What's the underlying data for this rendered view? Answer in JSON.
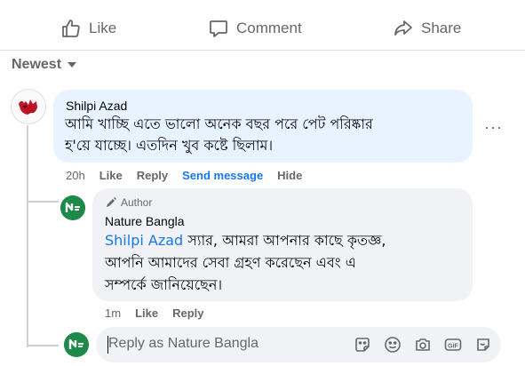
{
  "actions": {
    "like": "Like",
    "comment": "Comment",
    "share": "Share"
  },
  "sort": {
    "label": "Newest"
  },
  "comment": {
    "author": "Shilpi Azad",
    "text_line1": "আমি খাচ্ছি এতে ভালো অনেক বছর পরে পেট পরিষ্কার",
    "text_line2": "হ'য়ে যাচ্ছে। এতদিন খুব কষ্টে ছিলাম।",
    "time": "20h",
    "like": "Like",
    "reply": "Reply",
    "send_message": "Send message",
    "hide": "Hide",
    "more": "···"
  },
  "reply": {
    "badge": "Author",
    "author": "Nature Bangla",
    "mention": "Shilpi Azad",
    "text_line1": " স্যার, আমরা আপনার কাছে কৃতজ্ঞ,",
    "text_line2": "আপনি আমাদের সেবা গ্রহণ করেছেন এবং এ",
    "text_line3": "সম্পর্কে জানিয়েছেন।",
    "time": "1m",
    "like": "Like",
    "reply": "Reply"
  },
  "composer": {
    "placeholder": "Reply as Nature Bangla",
    "icons": [
      "sticker-icon",
      "emoji-icon",
      "camera-icon",
      "gif-icon",
      "avatar-sticker-icon"
    ]
  },
  "colors": {
    "accent": "#1877f2",
    "page_green": "#1e8a4a",
    "bubble_blue": "#e7f3ff",
    "bubble_gray": "#f0f2f5",
    "secondary_text": "#65676b"
  }
}
